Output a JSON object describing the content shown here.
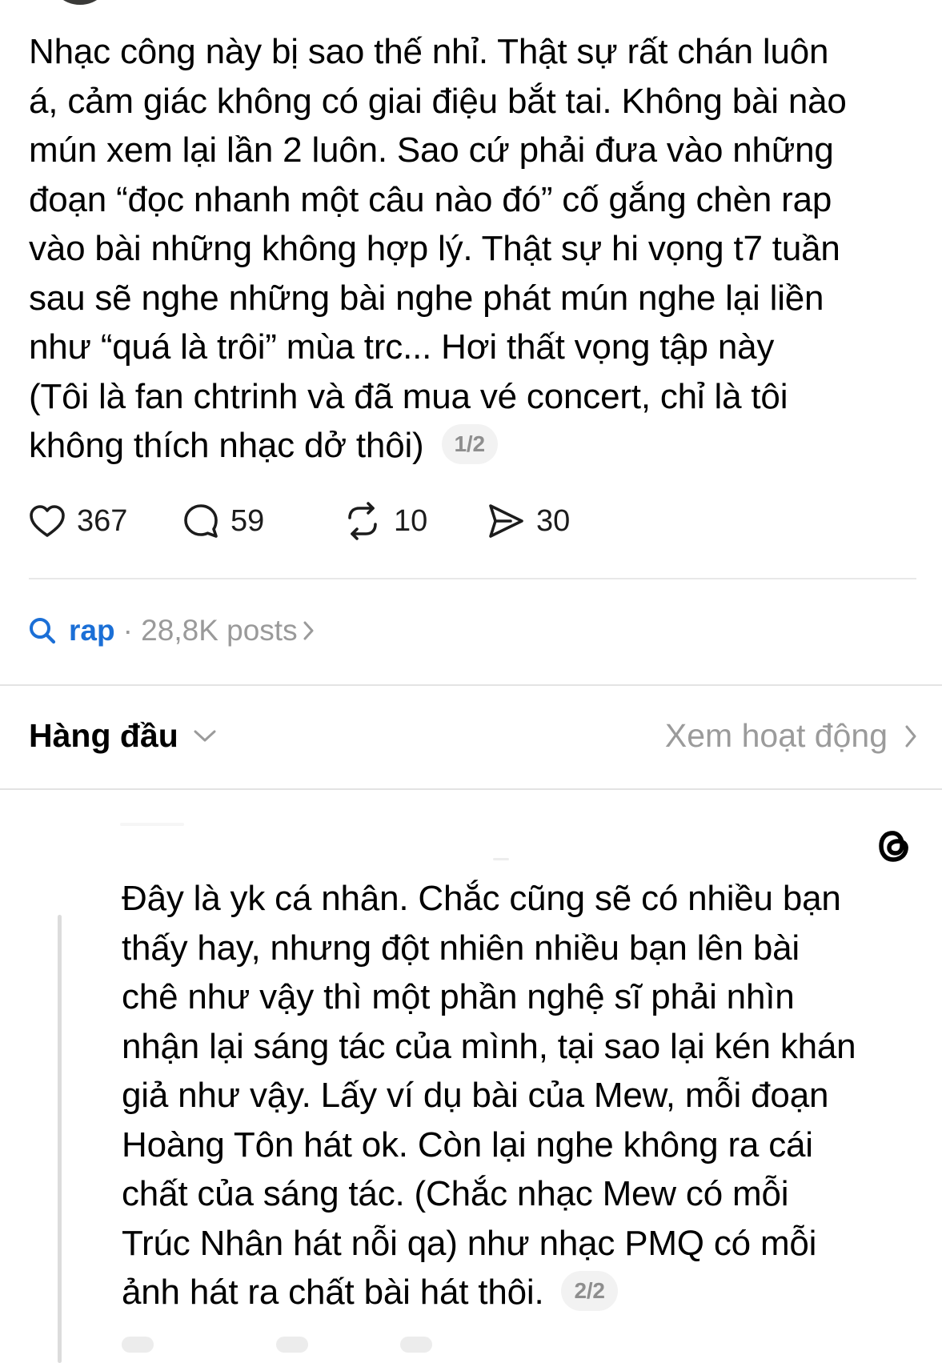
{
  "post": {
    "lines": [
      "Nhạc công này bị sao thế nhỉ. Thật sự rất chán luôn",
      "á, cảm giác không có giai điệu bắt tai. Không bài nào",
      "mún xem lại lần 2 luôn. Sao cứ phải đưa vào những",
      "đoạn “đọc nhanh một câu nào đó” cố gắng chèn rap",
      "vào bài những không hợp lý. Thật sự hi vọng t7 tuần",
      "sau sẽ nghe những bài nghe phát mún nghe lại liền",
      "như “quá là trôi” mùa trc... Hơi thất vọng tập này",
      "(Tôi là fan chtrinh và đã mua vé concert, chỉ là tôi",
      "không thích nhạc dở thôi)"
    ],
    "pager": "1/2",
    "likes": "367",
    "comments": "59",
    "reposts": "10",
    "shares": "30"
  },
  "topic": {
    "name": "rap",
    "meta": "· 28,8K posts"
  },
  "sort": {
    "label": "Hàng đầu",
    "activity": "Xem hoạt động"
  },
  "reply": {
    "lines": [
      "Đây là yk cá nhân. Chắc cũng sẽ có nhiều bạn",
      "thấy hay, nhưng đột nhiên nhiều bạn lên bài",
      "chê như vậy thì một phần nghệ sĩ phải nhìn",
      "nhận lại sáng tác của mình, tại sao lại kén khán",
      "giả như vậy. Lấy ví dụ bài của Mew, mỗi đoạn",
      "Hoàng Tôn hát ok. Còn lại nghe không ra  cái",
      "chất của sáng tác. (Chắc nhạc Mew có mỗi",
      "Trúc Nhân hát nỗi qa) như nhạc PMQ có mỗi",
      "ảnh hát ra chất bài hát thôi."
    ],
    "pager": "2/2"
  },
  "colors": {
    "accent": "#1b6fd6",
    "muted": "#9b9b9b",
    "divider": "#e3e3e3"
  },
  "icons": [
    "heart-icon",
    "comment-icon",
    "repost-icon",
    "share-icon",
    "search-icon",
    "chevron-right-icon",
    "chevron-down-icon",
    "threads-logo-icon"
  ]
}
